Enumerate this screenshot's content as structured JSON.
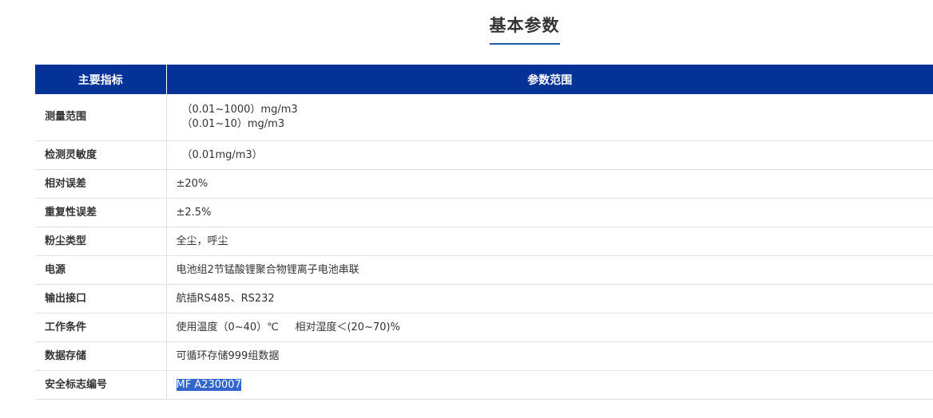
{
  "title": "基本参数",
  "table": {
    "headers": [
      "主要指标",
      "参数范围"
    ],
    "rows": [
      {
        "name": "测量范围",
        "values": [
          "（0.01~1000）mg/m3",
          "（0.01~10）mg/m3"
        ]
      },
      {
        "name": "检测灵敏度",
        "values": [
          "（0.01mg/m3）"
        ]
      },
      {
        "name": "相对误差",
        "values": [
          "±20%"
        ]
      },
      {
        "name": "重复性误差",
        "values": [
          "±2.5%"
        ]
      },
      {
        "name": "粉尘类型",
        "values": [
          "全尘，呼尘"
        ]
      },
      {
        "name": "电源",
        "values": [
          "电池组2节锰酸锂聚合物锂离子电池串联"
        ]
      },
      {
        "name": "输出接口",
        "values": [
          "航插RS485、RS232"
        ]
      },
      {
        "name": "工作条件",
        "values": [
          "使用温度（0~40）℃     相对湿度＜(20~70)%"
        ]
      },
      {
        "name": "数据存储",
        "values": [
          "可循环存储999组数据"
        ]
      },
      {
        "name": "安全标志编号",
        "values": [
          "MF A230007"
        ]
      }
    ]
  }
}
